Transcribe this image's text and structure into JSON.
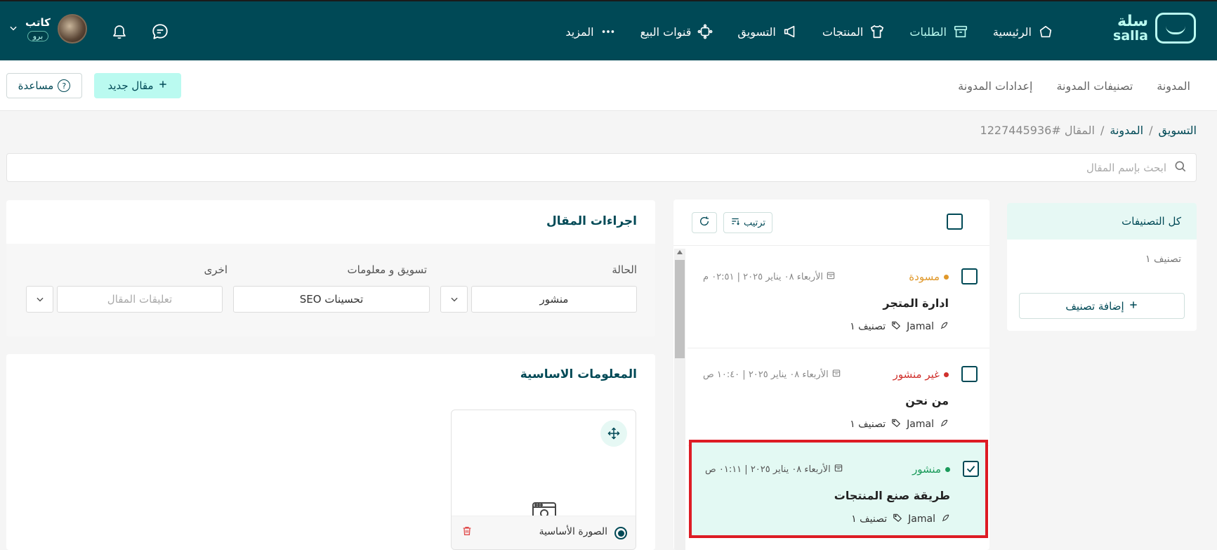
{
  "brand": {
    "name_ar": "سلة",
    "name_en": "salla"
  },
  "nav": {
    "home": "الرئيسية",
    "orders": "الطلبات",
    "products": "المنتجات",
    "marketing": "التسويق",
    "channels": "قنوات البيع",
    "more": "المزيد"
  },
  "user": {
    "name": "كاتب",
    "badge": "برو"
  },
  "subnav": {
    "tabs": [
      "المدونة",
      "تصنيفات المدونة",
      "إعدادات المدونة"
    ],
    "new_article": "مقال جديد",
    "help": "مساعدة"
  },
  "breadcrumb": {
    "root": "التسويق",
    "blog": "المدونة",
    "current": "المقال #1227445936"
  },
  "search": {
    "placeholder": "ابحث بإسم المقال"
  },
  "categories": {
    "header": "كل التصنيفات",
    "items": [
      "تصنيف ١"
    ],
    "add_label": "إضافة تصنيف"
  },
  "list": {
    "sort_label": "ترتيب",
    "articles": [
      {
        "status": "مسودة",
        "status_color": "#e0982a",
        "date": "الأربعاء ٠٨ يناير ٢٠٢٥ | ٠٢:٥١ م",
        "title": "ادارة المتجر",
        "author": "Jamal",
        "category": "تصنيف ١",
        "selected": false
      },
      {
        "status": "غير منشور",
        "status_color": "#d0312d",
        "date": "الأربعاء ٠٨ يناير ٢٠٢٥ | ١٠:٤٠ ص",
        "title": "من نحن",
        "author": "Jamal",
        "category": "تصنيف ١",
        "selected": false
      },
      {
        "status": "منشور",
        "status_color": "#1a9a5a",
        "date": "الأربعاء ٠٨ يناير ٢٠٢٥ | ٠١:١١ ص",
        "title": "طريقة صنع المنتجات",
        "author": "Jamal",
        "category": "تصنيف ١",
        "selected": true
      }
    ]
  },
  "actions": {
    "title": "اجراءات المقال",
    "status_label": "الحالة",
    "status_value": "منشور",
    "marketing_label": "تسويق و معلومات",
    "marketing_value": "تحسينات SEO",
    "other_label": "اخرى",
    "comments_placeholder": "تعليقات المقال"
  },
  "basic": {
    "title": "المعلومات الاساسية",
    "main_image_label": "الصورة الأساسية"
  },
  "colors": {
    "primary": "#004956",
    "accent": "#bafaf0",
    "highlight": "#dd1c24"
  },
  "icons": [
    "home-icon",
    "archive-icon",
    "shirt-icon",
    "megaphone-icon",
    "channels-icon",
    "dots-icon",
    "bell-icon",
    "chat-icon",
    "search-icon",
    "sort-icon",
    "refresh-icon",
    "calendar-icon",
    "feather-icon",
    "tag-icon",
    "move-icon",
    "image-icon",
    "trash-icon",
    "plus-icon",
    "help-icon",
    "check-icon",
    "chevron-down-icon"
  ]
}
